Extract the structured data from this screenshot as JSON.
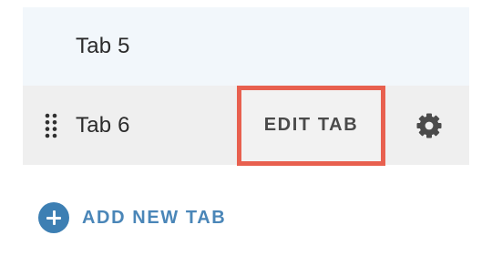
{
  "tabs": [
    {
      "label": "Tab 5"
    },
    {
      "label": "Tab 6",
      "edit_label": "EDIT TAB"
    }
  ],
  "add_tab": {
    "label": "ADD NEW TAB",
    "icon": "plus-circle-icon",
    "color": "#3d7fb3"
  },
  "icons": {
    "drag": "drag-handle-icon",
    "settings": "gear-icon"
  },
  "colors": {
    "highlight_border": "#e8604f",
    "tab_5_bg": "#f2f7fb",
    "tab_6_bg": "#efefef",
    "link": "#4a86b8"
  }
}
